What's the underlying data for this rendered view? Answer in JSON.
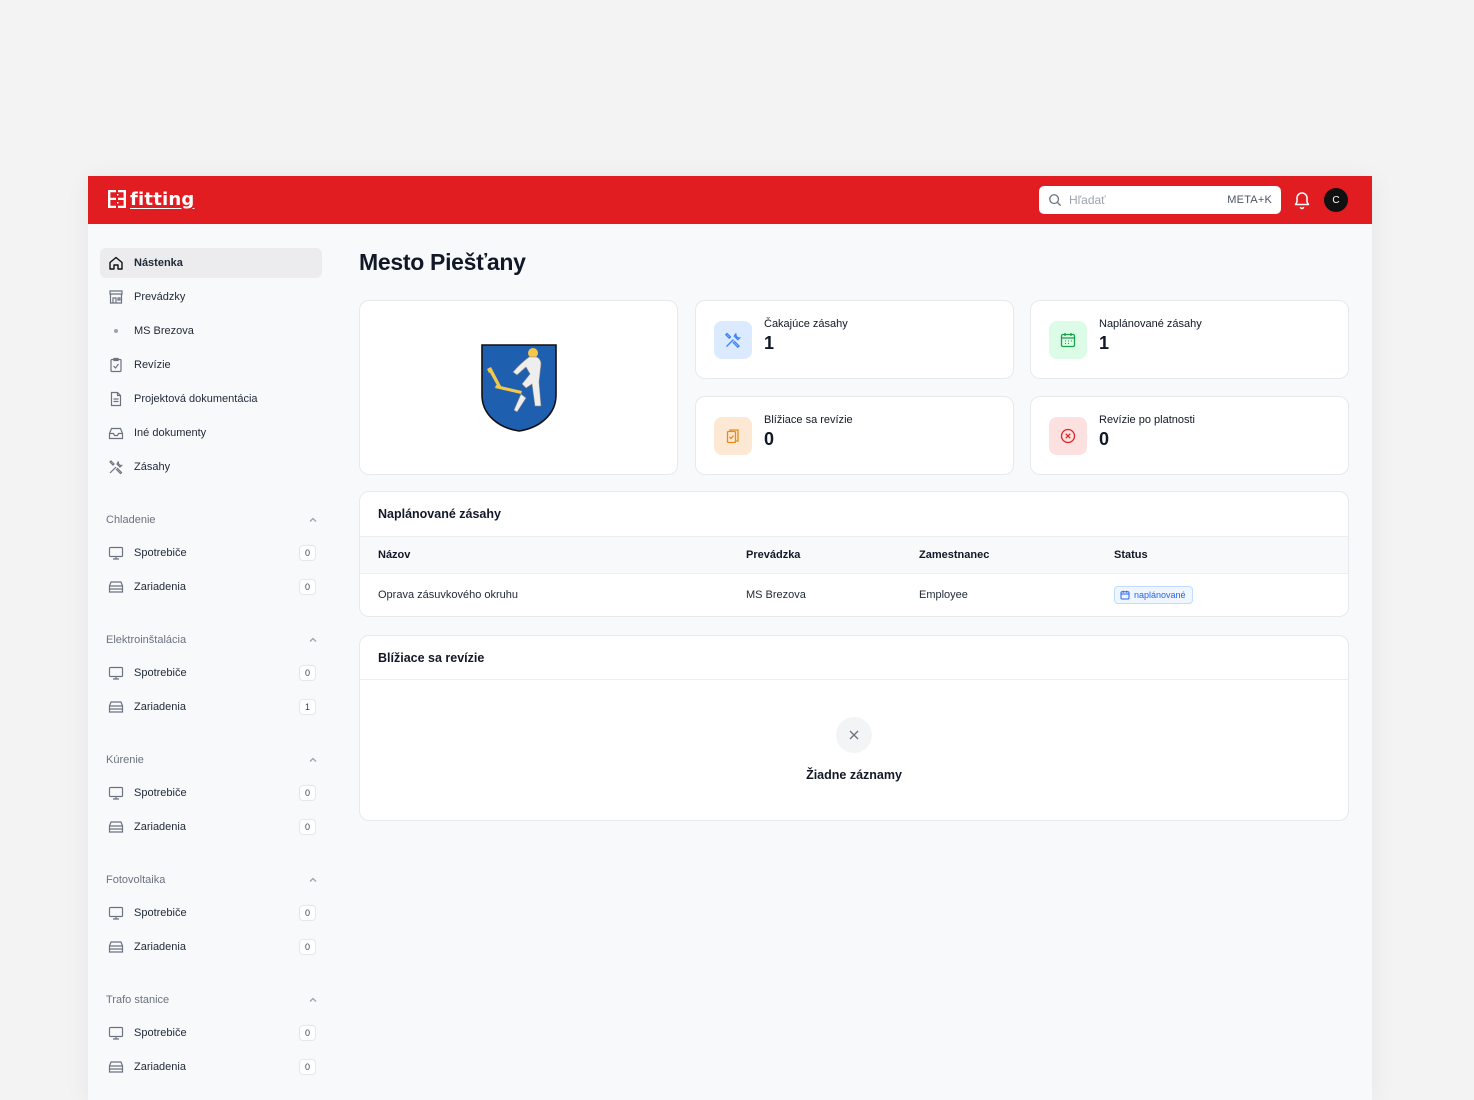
{
  "header": {
    "logo_text": "fitting",
    "search_placeholder": "Hľadať",
    "search_shortcut": "META+K",
    "avatar_initial": "C"
  },
  "sidebar": {
    "items": [
      {
        "label": "Nástenka",
        "icon": "home-icon",
        "active": true
      },
      {
        "label": "Prevádzky",
        "icon": "store-icon"
      },
      {
        "label": "MS Brezova",
        "icon": "dot-icon"
      },
      {
        "label": "Revízie",
        "icon": "clipboard-check-icon"
      },
      {
        "label": "Projektová dokumentácia",
        "icon": "file-text-icon"
      },
      {
        "label": "Iné dokumenty",
        "icon": "inbox-icon"
      },
      {
        "label": "Zásahy",
        "icon": "tools-icon"
      }
    ],
    "sections": [
      {
        "title": "Chladenie",
        "items": [
          {
            "label": "Spotrebiče",
            "count": "0"
          },
          {
            "label": "Zariadenia",
            "count": "0"
          }
        ]
      },
      {
        "title": "Elektroinštalácia",
        "items": [
          {
            "label": "Spotrebiče",
            "count": "0"
          },
          {
            "label": "Zariadenia",
            "count": "1"
          }
        ]
      },
      {
        "title": "Kúrenie",
        "items": [
          {
            "label": "Spotrebiče",
            "count": "0"
          },
          {
            "label": "Zariadenia",
            "count": "0"
          }
        ]
      },
      {
        "title": "Fotovoltaika",
        "items": [
          {
            "label": "Spotrebiče",
            "count": "0"
          },
          {
            "label": "Zariadenia",
            "count": "0"
          }
        ]
      },
      {
        "title": "Trafo stanice",
        "items": [
          {
            "label": "Spotrebiče",
            "count": "0"
          },
          {
            "label": "Zariadenia",
            "count": "0"
          }
        ]
      }
    ]
  },
  "main": {
    "title": "Mesto Piešťany",
    "stats": [
      {
        "label": "Čakajúce zásahy",
        "value": "1",
        "icon": "tools-icon",
        "color": "#3b82f6",
        "bg": "#dbeafe"
      },
      {
        "label": "Naplánované zásahy",
        "value": "1",
        "icon": "calendar-icon",
        "color": "#16a34a",
        "bg": "#dcfce7"
      },
      {
        "label": "Blížiace sa revízie",
        "value": "0",
        "icon": "clipboard-icon",
        "color": "#ea8a1d",
        "bg": "#fde9d3"
      },
      {
        "label": "Revízie po platnosti",
        "value": "0",
        "icon": "x-circle-icon",
        "color": "#dc2626",
        "bg": "#fde0e0"
      }
    ],
    "planned": {
      "title": "Naplánované zásahy",
      "columns": [
        "Názov",
        "Prevádzka",
        "Zamestnanec",
        "Status"
      ],
      "rows": [
        {
          "name": "Oprava zásuvkového okruhu",
          "site": "MS Brezova",
          "employee": "Employee",
          "status": "naplánované"
        }
      ]
    },
    "upcoming": {
      "title": "Blížiace sa revízie",
      "empty_text": "Žiadne záznamy"
    }
  },
  "colors": {
    "brand": "#e11d22"
  }
}
